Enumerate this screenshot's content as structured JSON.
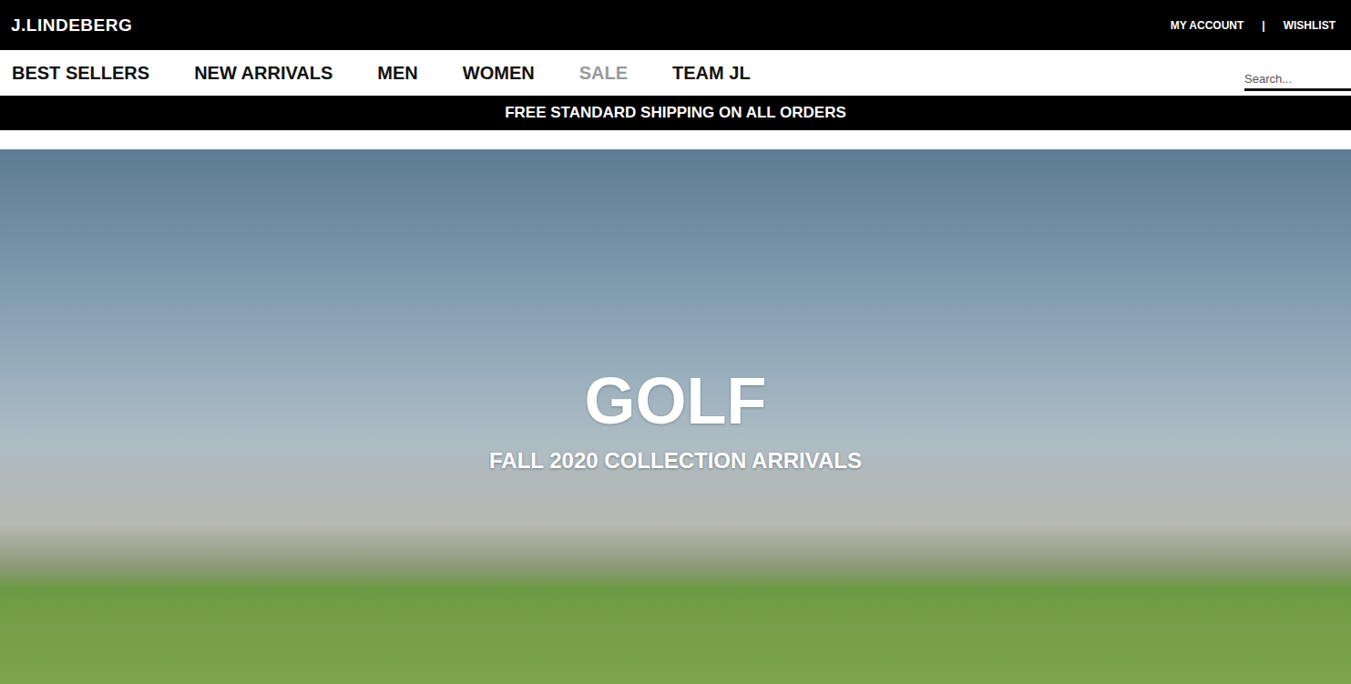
{
  "header": {
    "logo": "J.LINDEBERG",
    "links": [
      "MY ACCOUNT",
      "WISHLIST"
    ],
    "separator": "|"
  },
  "nav": {
    "items": [
      {
        "label": "BEST SELLERS",
        "dimmed": false
      },
      {
        "label": "NEW ARRIVALS",
        "dimmed": false
      },
      {
        "label": "MEN",
        "dimmed": false
      },
      {
        "label": "WOMEN",
        "dimmed": false
      },
      {
        "label": "SALE",
        "dimmed": true
      },
      {
        "label": "TEAM JL",
        "dimmed": false
      }
    ]
  },
  "search": {
    "placeholder": "Search..."
  },
  "banner": {
    "text": "FREE STANDARD SHIPPING ON ALL ORDERS"
  },
  "hero": {
    "title": "GOLF",
    "subtitle": "FALL 2020 COLLECTION ARRIVALS"
  }
}
